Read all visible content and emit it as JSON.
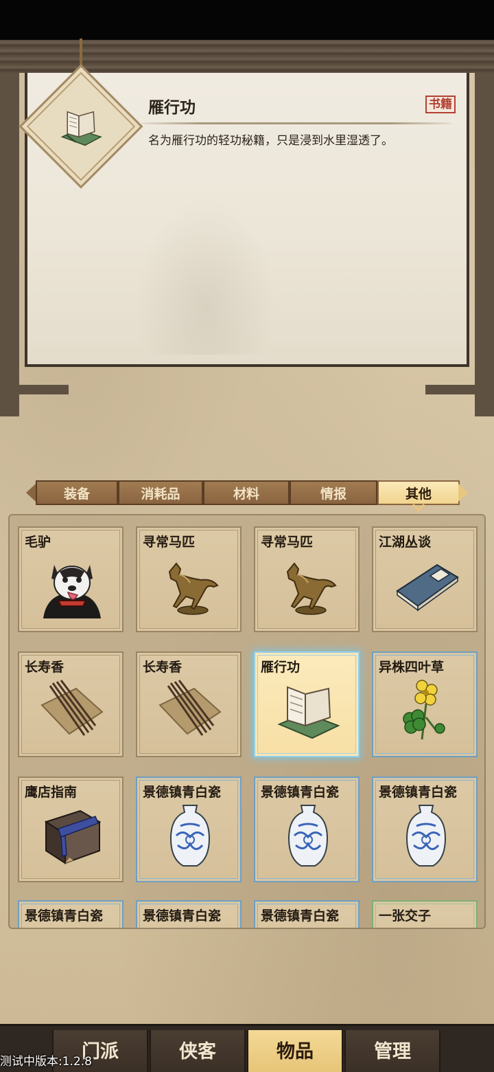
{
  "item_detail": {
    "name": "雁行功",
    "category_tag": "书籍",
    "description": "名为雁行功的轻功秘籍，只是浸到水里湿透了。",
    "icon": "book-icon"
  },
  "tabs": [
    {
      "label": "装备",
      "active": false
    },
    {
      "label": "消耗品",
      "active": false
    },
    {
      "label": "材料",
      "active": false
    },
    {
      "label": "情报",
      "active": false
    },
    {
      "label": "其他",
      "active": true
    }
  ],
  "items": [
    {
      "name": "毛驴",
      "icon": "husky-donkey-icon",
      "rarity": "common",
      "selected": false
    },
    {
      "name": "寻常马匹",
      "icon": "bronze-horse-icon",
      "rarity": "common",
      "selected": false
    },
    {
      "name": "寻常马匹",
      "icon": "bronze-horse-icon",
      "rarity": "common",
      "selected": false
    },
    {
      "name": "江湖丛谈",
      "icon": "blue-book-icon",
      "rarity": "common",
      "selected": false
    },
    {
      "name": "长寿香",
      "icon": "incense-icon",
      "rarity": "common",
      "selected": false
    },
    {
      "name": "长寿香",
      "icon": "incense-icon",
      "rarity": "common",
      "selected": false
    },
    {
      "name": "雁行功",
      "icon": "open-book-icon",
      "rarity": "rare",
      "selected": true
    },
    {
      "name": "异株四叶草",
      "icon": "clover-icon",
      "rarity": "rare",
      "selected": false
    },
    {
      "name": "鹰店指南",
      "icon": "guidebook-icon",
      "rarity": "common",
      "selected": false
    },
    {
      "name": "景德镇青白瓷",
      "icon": "porcelain-vase-icon",
      "rarity": "rare",
      "selected": false
    },
    {
      "name": "景德镇青白瓷",
      "icon": "porcelain-vase-icon",
      "rarity": "rare",
      "selected": false
    },
    {
      "name": "景德镇青白瓷",
      "icon": "porcelain-vase-icon",
      "rarity": "rare",
      "selected": false
    },
    {
      "name": "景德镇青白瓷",
      "icon": "porcelain-vase-icon",
      "rarity": "rare",
      "selected": false
    },
    {
      "name": "景德镇青白瓷",
      "icon": "porcelain-vase-icon",
      "rarity": "rare",
      "selected": false
    },
    {
      "name": "景德镇青白瓷",
      "icon": "porcelain-vase-icon",
      "rarity": "rare",
      "selected": false
    },
    {
      "name": "一张交子",
      "icon": "paper-money-icon",
      "rarity": "uncommon",
      "selected": false
    }
  ],
  "bottom_nav": [
    {
      "label": "门派",
      "active": false
    },
    {
      "label": "侠客",
      "active": false
    },
    {
      "label": "物品",
      "active": true
    },
    {
      "label": "管理",
      "active": false
    }
  ],
  "version_text": "测试中版本:1.2.8",
  "colors": {
    "active_tab": "#f1d48f",
    "selected_glow": "#8fd0ea",
    "rare_border": "#6f9fc1",
    "uncommon_border": "#7fae74",
    "tag_red": "#b24032"
  }
}
